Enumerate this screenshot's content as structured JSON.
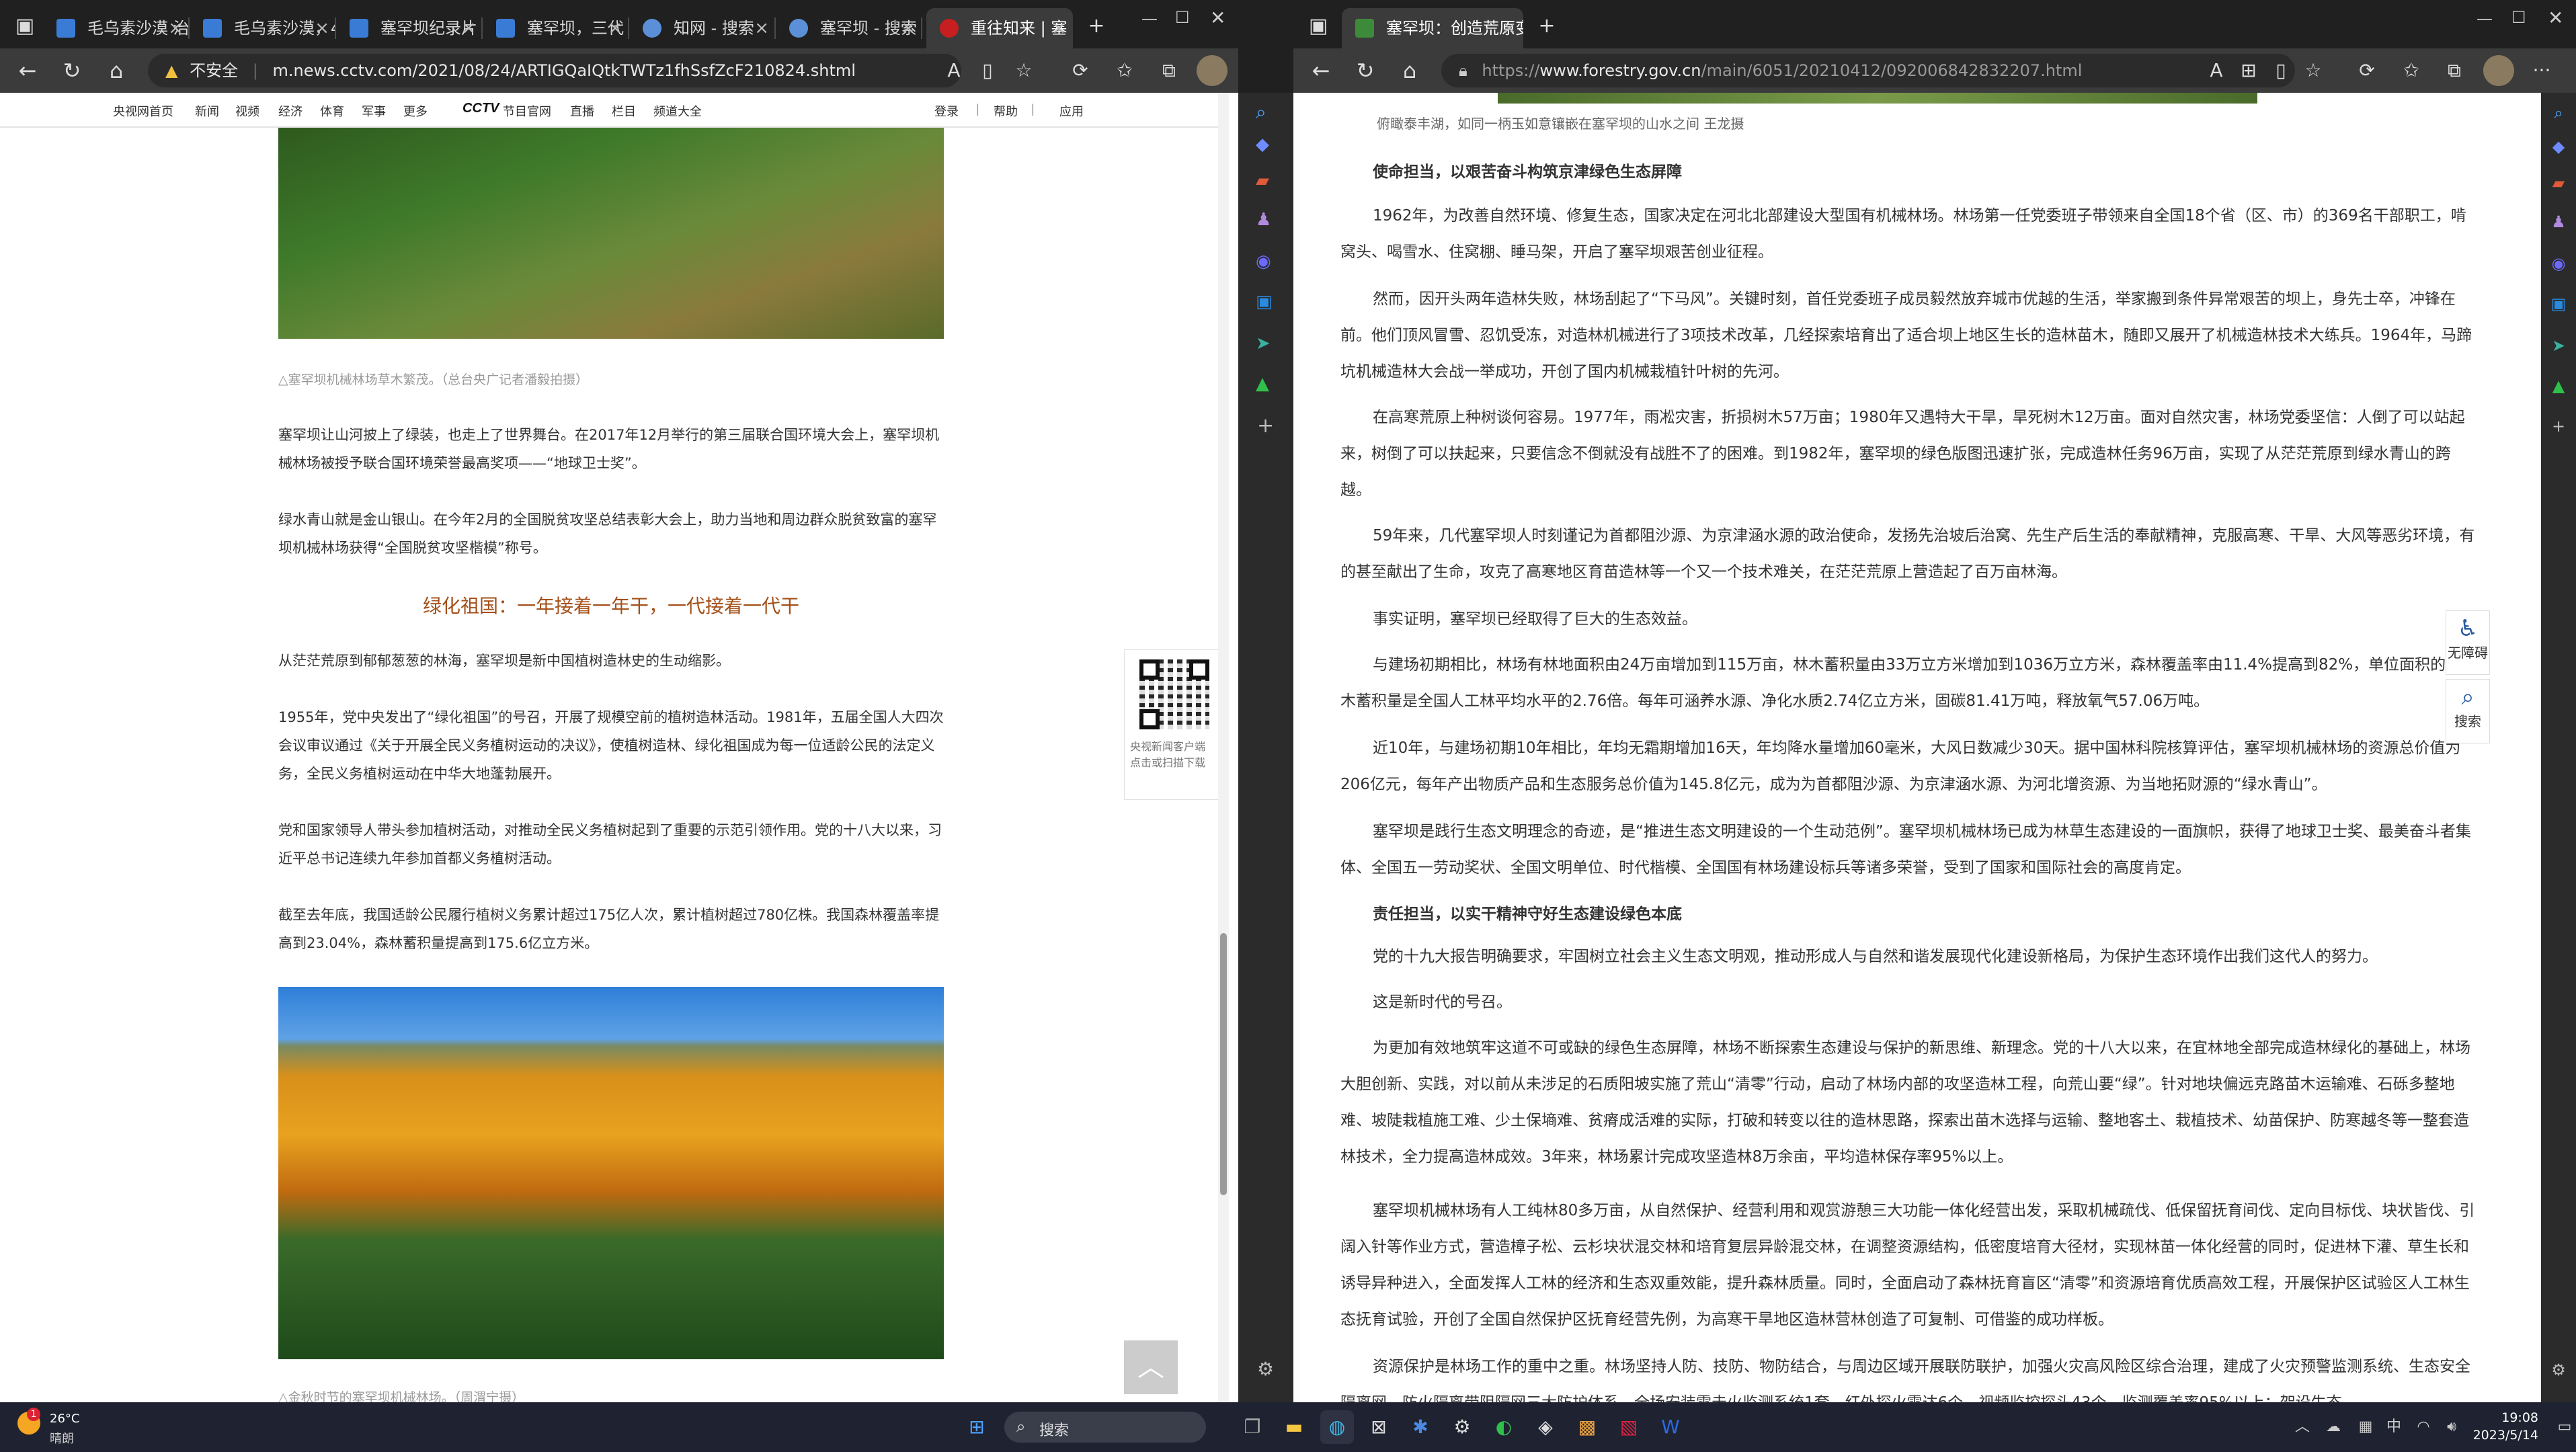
{
  "left_window": {
    "tabs": [
      {
        "label": "毛乌素沙漠 治"
      },
      {
        "label": "毛乌素沙漠，4"
      },
      {
        "label": "塞罕坝纪录片"
      },
      {
        "label": "塞罕坝，三代"
      },
      {
        "label": "知网 - 搜索"
      },
      {
        "label": "塞罕坝 - 搜索"
      },
      {
        "label": "重往知来 | 塞"
      }
    ],
    "security_label": "不安全",
    "url": "m.news.cctv.com/2021/08/24/ARTIGQaIQtkTWTz1fhSsfZcF210824.shtml",
    "site_nav": {
      "items": [
        "央视网首页",
        "新闻",
        "视频",
        "经济",
        "体育",
        "军事",
        "更多"
      ],
      "brand": "CCTV",
      "brand_suffix": "节目官网",
      "items2": [
        "直播",
        "栏目",
        "频道大全"
      ],
      "right": [
        "登录",
        "|",
        "帮助",
        "|",
        "应用"
      ]
    },
    "article": {
      "caption1": "△塞罕坝机械林场草木繁茂。（总台央广记者潘毅拍摄）",
      "p1": "塞罕坝让山河披上了绿装，也走上了世界舞台。在2017年12月举行的第三届联合国环境大会上，塞罕坝机械林场被授予联合国环境荣誉最高奖项——“地球卫士奖”。",
      "p2": "绿水青山就是金山银山。在今年2月的全国脱贫攻坚总结表彰大会上，助力当地和周边群众脱贫致富的塞罕坝机械林场获得“全国脱贫攻坚楷模”称号。",
      "heading": "绿化祖国：一年接着一年干，一代接着一代干",
      "p3": "从茫茫荒原到郁郁葱葱的林海，塞罕坝是新中国植树造林史的生动缩影。",
      "p4": "1955年，党中央发出了“绿化祖国”的号召，开展了规模空前的植树造林活动。1981年，五届全国人大四次会议审议通过《关于开展全民义务植树运动的决议》，使植树造林、绿化祖国成为每一位适龄公民的法定义务，全民义务植树运动在中华大地蓬勃展开。",
      "p5": "党和国家领导人带头参加植树活动，对推动全民义务植树起到了重要的示范引领作用。党的十八大以来，习近平总书记连续九年参加首都义务植树活动。",
      "p6": "截至去年底，我国适龄公民履行植树义务累计超过175亿人次，累计植树超过780亿株。我国森林覆盖率提高到23.04%，森林蓄积量提高到175.6亿立方米。",
      "caption2": "△金秋时节的塞罕坝机械林场。（周渭宁摄）"
    },
    "qr_text": "央视新闻客户端 点击或扫描下载",
    "totop": "︿"
  },
  "right_window": {
    "tab_label": "塞罕坝：创造荒原变林海的人间",
    "url_prefix": "https://",
    "url_domain": "www.forestry.gov.cn",
    "url_path": "/main/6051/20210412/092006842832207.html",
    "photo_caption": "俯瞰泰丰湖，如同一柄玉如意镶嵌在塞罕坝的山水之间 王龙摄",
    "sub1": "使命担当，以艰苦奋斗构筑京津绿色生态屏障",
    "paras1": [
      "1962年，为改善自然环境、修复生态，国家决定在河北北部建设大型国有机械林场。林场第一任党委班子带领来自全国18个省（区、市）的369名干部职工，啃窝头、喝雪水、住窝棚、睡马架，开启了塞罕坝艰苦创业征程。",
      "然而，因开头两年造林失败，林场刮起了“下马风”。关键时刻，首任党委班子成员毅然放弃城市优越的生活，举家搬到条件异常艰苦的坝上，身先士卒，冲锋在前。他们顶风冒雪、忍饥受冻，对造林机械进行了3项技术改革，几经探索培育出了适合坝上地区生长的造林苗木，随即又展开了机械造林技术大练兵。1964年，马蹄坑机械造林大会战一举成功，开创了国内机械栽植针叶树的先河。",
      "在高寒荒原上种树谈何容易。1977年，雨凇灾害，折损树木57万亩；1980年又遇特大干旱，旱死树木12万亩。面对自然灾害，林场党委坚信：人倒了可以站起来，树倒了可以扶起来，只要信念不倒就没有战胜不了的困难。到1982年，塞罕坝的绿色版图迅速扩张，完成造林任务96万亩，实现了从茫茫荒原到绿水青山的跨越。",
      "59年来，几代塞罕坝人时刻谨记为首都阻沙源、为京津涵水源的政治使命，发扬先治坡后治窝、先生产后生活的奉献精神，克服高寒、干旱、大风等恶劣环境，有的甚至献出了生命，攻克了高寒地区育苗造林等一个又一个技术难关，在茫茫荒原上营造起了百万亩林海。",
      "事实证明，塞罕坝已经取得了巨大的生态效益。",
      "与建场初期相比，林场有林地面积由24万亩增加到115万亩，林木蓄积量由33万立方米增加到1036万立方米，森林覆盖率由11.4%提高到82%，单位面积的林木蓄积量是全国人工林平均水平的2.76倍。每年可涵养水源、净化水质2.74亿立方米，固碳81.41万吨，释放氧气57.06万吨。",
      "近10年，与建场初期10年相比，年均无霜期增加16天，年均降水量增加60毫米，大风日数减少30天。据中国林科院核算评估，塞罕坝机械林场的资源总价值为206亿元，每年产出物质产品和生态服务总价值为145.8亿元，成为为首都阻沙源、为京津涵水源、为河北增资源、为当地拓财源的“绿水青山”。",
      "塞罕坝是践行生态文明理念的奇迹，是“推进生态文明建设的一个生动范例”。塞罕坝机械林场已成为林草生态建设的一面旗帜，获得了地球卫士奖、最美奋斗者集体、全国五一劳动奖状、全国文明单位、时代楷模、全国国有林场建设标兵等诸多荣誉，受到了国家和国际社会的高度肯定。"
    ],
    "sub2": "责任担当，以实干精神守好生态建设绿色本底",
    "paras2": [
      "党的十九大报告明确要求，牢固树立社会主义生态文明观，推动形成人与自然和谐发展现代化建设新格局，为保护生态环境作出我们这代人的努力。",
      "这是新时代的号召。",
      "为更加有效地筑牢这道不可或缺的绿色生态屏障，林场不断探索生态建设与保护的新思维、新理念。党的十八大以来，在宜林地全部完成造林绿化的基础上，林场大胆创新、实践，对以前从未涉足的石质阳坡实施了荒山“清零”行动，启动了林场内部的攻坚造林工程，向荒山要“绿”。针对地块偏远克路苗木运输难、石砾多整地难、坡陡栽植施工难、少土保墒难、贫瘠成活难的实际，打破和转变以往的造林思路，探索出苗木选择与运输、整地客土、栽植技术、幼苗保护、防寒越冬等一整套造林技术，全力提高造林成效。3年来，林场累计完成攻坚造林8万余亩，平均造林保存率95%以上。",
      "塞罕坝机械林场有人工纯林80多万亩，从自然保护、经营利用和观赏游憩三大功能一体化经营出发，采取机械疏伐、低保留抚育间伐、定向目标伐、块状皆伐、引阔入针等作业方式，营造樟子松、云杉块状混交林和培育复层异龄混交林，在调整资源结构，低密度培育大径材，实现林苗一体化经营的同时，促进林下灌、草生长和诱导异种进入，全面发挥人工林的经济和生态双重效能，提升森林质量。同时，全面启动了森林抚育盲区“清零”和资源培育优质高效工程，开展保护区试验区人工林生态抚育试验，开创了全国自然保护区抚育经营先例，为高寒干旱地区造林营林创造了可复制、可借鉴的成功样板。",
      "资源保护是林场工作的重中之重。林场坚持人防、技防、物防结合，与周边区域开展联防联护，加强火灾高风险区综合治理，建成了火灾预警监测系统、生态安全隔离网、防火隔离带阻隔网三大防护体系，全场安装雷击火监测系统1套、红外探火雷达6个、视频监控探头43个，监测覆盖率95%以上；架设生态"
    ],
    "float1": "无障碍",
    "float2": "搜索"
  },
  "taskbar": {
    "weather_temp": "26°C",
    "weather_desc": "晴朗",
    "search_label": "搜索",
    "ime": "中",
    "time": "19:08",
    "date": "2023/5/14",
    "notif_count": "1"
  }
}
